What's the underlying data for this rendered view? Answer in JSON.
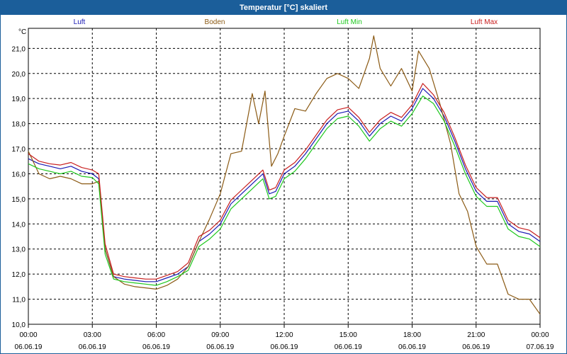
{
  "window": {
    "title": "Temperatur [°C] skaliert"
  },
  "colors": {
    "titlebar": "#1b5e9a",
    "luft": "#1a1ab4",
    "boden": "#8b5a14",
    "luft_min": "#1ec81e",
    "luft_max": "#c81e1e"
  },
  "chart_data": {
    "type": "line",
    "title": "Temperatur [°C] skaliert",
    "ylabel": "°C",
    "xlabel": "",
    "ylim": [
      10.0,
      21.8
    ],
    "xlim": [
      0,
      24
    ],
    "grid": true,
    "legend_position": "top",
    "y_ticks": [
      "10,0",
      "11,0",
      "12,0",
      "13,0",
      "14,0",
      "15,0",
      "16,0",
      "17,0",
      "18,0",
      "19,0",
      "20,0",
      "21,0"
    ],
    "x_ticks": [
      {
        "time": "00:00",
        "date": "06.06.19"
      },
      {
        "time": "03:00",
        "date": "06.06.19"
      },
      {
        "time": "06:00",
        "date": "06.06.19"
      },
      {
        "time": "09:00",
        "date": "06.06.19"
      },
      {
        "time": "12:00",
        "date": "06.06.19"
      },
      {
        "time": "15:00",
        "date": "06.06.19"
      },
      {
        "time": "18:00",
        "date": "06.06.19"
      },
      {
        "time": "21:00",
        "date": "06.06.19"
      },
      {
        "time": "00:00",
        "date": "07.06.19"
      }
    ],
    "series": [
      {
        "name": "Luft",
        "color": "#1a1ab4",
        "points": [
          [
            0,
            16.6
          ],
          [
            0.5,
            16.4
          ],
          [
            1,
            16.3
          ],
          [
            1.5,
            16.2
          ],
          [
            2,
            16.3
          ],
          [
            2.5,
            16.1
          ],
          [
            3,
            16.0
          ],
          [
            3.3,
            15.8
          ],
          [
            3.6,
            13.0
          ],
          [
            4.0,
            11.9
          ],
          [
            4.5,
            11.8
          ],
          [
            5,
            11.75
          ],
          [
            5.5,
            11.7
          ],
          [
            6,
            11.7
          ],
          [
            6.5,
            11.85
          ],
          [
            7,
            12.0
          ],
          [
            7.5,
            12.3
          ],
          [
            8,
            13.3
          ],
          [
            8.5,
            13.6
          ],
          [
            9,
            14.0
          ],
          [
            9.5,
            14.8
          ],
          [
            10,
            15.2
          ],
          [
            10.5,
            15.6
          ],
          [
            11,
            16.0
          ],
          [
            11.3,
            15.2
          ],
          [
            11.6,
            15.3
          ],
          [
            12,
            16.0
          ],
          [
            12.5,
            16.3
          ],
          [
            13,
            16.8
          ],
          [
            13.5,
            17.4
          ],
          [
            14,
            18.0
          ],
          [
            14.5,
            18.4
          ],
          [
            15,
            18.5
          ],
          [
            15.5,
            18.1
          ],
          [
            16,
            17.5
          ],
          [
            16.5,
            18.0
          ],
          [
            17,
            18.3
          ],
          [
            17.5,
            18.1
          ],
          [
            18,
            18.6
          ],
          [
            18.5,
            19.4
          ],
          [
            19,
            19.0
          ],
          [
            19.5,
            18.3
          ],
          [
            20,
            17.3
          ],
          [
            20.5,
            16.2
          ],
          [
            21,
            15.3
          ],
          [
            21.5,
            14.9
          ],
          [
            22,
            14.9
          ],
          [
            22.5,
            14.0
          ],
          [
            23,
            13.7
          ],
          [
            23.5,
            13.6
          ],
          [
            24,
            13.3
          ]
        ]
      },
      {
        "name": "Boden",
        "color": "#8b5a14",
        "points": [
          [
            0,
            16.9
          ],
          [
            0.5,
            16.0
          ],
          [
            1,
            15.8
          ],
          [
            1.5,
            15.9
          ],
          [
            2,
            15.8
          ],
          [
            2.5,
            15.6
          ],
          [
            3,
            15.6
          ],
          [
            3.3,
            15.7
          ],
          [
            3.6,
            13.0
          ],
          [
            4.0,
            11.9
          ],
          [
            4.5,
            11.6
          ],
          [
            5,
            11.5
          ],
          [
            5.5,
            11.45
          ],
          [
            6,
            11.4
          ],
          [
            6.5,
            11.55
          ],
          [
            7,
            11.8
          ],
          [
            7.5,
            12.3
          ],
          [
            8,
            13.3
          ],
          [
            8.5,
            14.2
          ],
          [
            9,
            15.2
          ],
          [
            9.5,
            16.8
          ],
          [
            10,
            16.9
          ],
          [
            10.5,
            19.2
          ],
          [
            10.8,
            18.0
          ],
          [
            11.1,
            19.3
          ],
          [
            11.4,
            16.3
          ],
          [
            11.7,
            16.8
          ],
          [
            12,
            17.5
          ],
          [
            12.5,
            18.6
          ],
          [
            13,
            18.5
          ],
          [
            13.5,
            19.2
          ],
          [
            14,
            19.8
          ],
          [
            14.5,
            20.0
          ],
          [
            15,
            19.8
          ],
          [
            15.5,
            19.4
          ],
          [
            16,
            20.6
          ],
          [
            16.2,
            21.5
          ],
          [
            16.5,
            20.2
          ],
          [
            17,
            19.5
          ],
          [
            17.5,
            20.2
          ],
          [
            18,
            19.3
          ],
          [
            18.3,
            20.9
          ],
          [
            18.8,
            20.2
          ],
          [
            19.3,
            18.8
          ],
          [
            19.8,
            17.2
          ],
          [
            20.2,
            15.2
          ],
          [
            20.6,
            14.5
          ],
          [
            21,
            13.1
          ],
          [
            21.5,
            12.4
          ],
          [
            22,
            12.4
          ],
          [
            22.5,
            11.2
          ],
          [
            23,
            11.0
          ],
          [
            23.5,
            11.0
          ],
          [
            24,
            10.4
          ]
        ]
      },
      {
        "name": "Luft Min",
        "color": "#1ec81e",
        "points": [
          [
            0,
            16.4
          ],
          [
            0.5,
            16.2
          ],
          [
            1,
            16.1
          ],
          [
            1.5,
            16.0
          ],
          [
            2,
            16.1
          ],
          [
            2.5,
            15.9
          ],
          [
            3,
            15.85
          ],
          [
            3.3,
            15.6
          ],
          [
            3.6,
            12.8
          ],
          [
            4.0,
            11.8
          ],
          [
            4.5,
            11.7
          ],
          [
            5,
            11.65
          ],
          [
            5.5,
            11.6
          ],
          [
            6,
            11.55
          ],
          [
            6.5,
            11.7
          ],
          [
            7,
            11.9
          ],
          [
            7.5,
            12.15
          ],
          [
            8,
            13.1
          ],
          [
            8.5,
            13.4
          ],
          [
            9,
            13.8
          ],
          [
            9.5,
            14.6
          ],
          [
            10,
            15.0
          ],
          [
            10.5,
            15.4
          ],
          [
            11,
            15.8
          ],
          [
            11.3,
            15.0
          ],
          [
            11.6,
            15.1
          ],
          [
            12,
            15.8
          ],
          [
            12.5,
            16.1
          ],
          [
            13,
            16.6
          ],
          [
            13.5,
            17.2
          ],
          [
            14,
            17.8
          ],
          [
            14.5,
            18.2
          ],
          [
            15,
            18.3
          ],
          [
            15.5,
            17.9
          ],
          [
            16,
            17.3
          ],
          [
            16.5,
            17.8
          ],
          [
            17,
            18.1
          ],
          [
            17.5,
            17.9
          ],
          [
            18,
            18.4
          ],
          [
            18.5,
            19.1
          ],
          [
            19,
            18.8
          ],
          [
            19.5,
            18.1
          ],
          [
            20,
            17.1
          ],
          [
            20.5,
            16.0
          ],
          [
            21,
            15.1
          ],
          [
            21.5,
            14.7
          ],
          [
            22,
            14.7
          ],
          [
            22.5,
            13.8
          ],
          [
            23,
            13.5
          ],
          [
            23.5,
            13.4
          ],
          [
            24,
            13.1
          ]
        ]
      },
      {
        "name": "Luft Max",
        "color": "#c81e1e",
        "points": [
          [
            0,
            16.8
          ],
          [
            0.5,
            16.5
          ],
          [
            1,
            16.4
          ],
          [
            1.5,
            16.35
          ],
          [
            2,
            16.45
          ],
          [
            2.5,
            16.25
          ],
          [
            3,
            16.15
          ],
          [
            3.3,
            16.0
          ],
          [
            3.6,
            13.2
          ],
          [
            4.0,
            12.0
          ],
          [
            4.5,
            11.9
          ],
          [
            5,
            11.85
          ],
          [
            5.5,
            11.8
          ],
          [
            6,
            11.8
          ],
          [
            6.5,
            11.95
          ],
          [
            7,
            12.1
          ],
          [
            7.5,
            12.45
          ],
          [
            8,
            13.5
          ],
          [
            8.5,
            13.75
          ],
          [
            9,
            14.15
          ],
          [
            9.5,
            14.95
          ],
          [
            10,
            15.35
          ],
          [
            10.5,
            15.75
          ],
          [
            11,
            16.15
          ],
          [
            11.3,
            15.35
          ],
          [
            11.6,
            15.45
          ],
          [
            12,
            16.15
          ],
          [
            12.5,
            16.45
          ],
          [
            13,
            16.95
          ],
          [
            13.5,
            17.55
          ],
          [
            14,
            18.15
          ],
          [
            14.5,
            18.55
          ],
          [
            15,
            18.65
          ],
          [
            15.5,
            18.25
          ],
          [
            16,
            17.65
          ],
          [
            16.5,
            18.15
          ],
          [
            17,
            18.45
          ],
          [
            17.5,
            18.25
          ],
          [
            18,
            18.75
          ],
          [
            18.5,
            19.6
          ],
          [
            19,
            19.15
          ],
          [
            19.5,
            18.45
          ],
          [
            20,
            17.45
          ],
          [
            20.5,
            16.35
          ],
          [
            21,
            15.45
          ],
          [
            21.5,
            15.05
          ],
          [
            22,
            15.05
          ],
          [
            22.5,
            14.15
          ],
          [
            23,
            13.85
          ],
          [
            23.5,
            13.75
          ],
          [
            24,
            13.45
          ]
        ]
      }
    ]
  }
}
